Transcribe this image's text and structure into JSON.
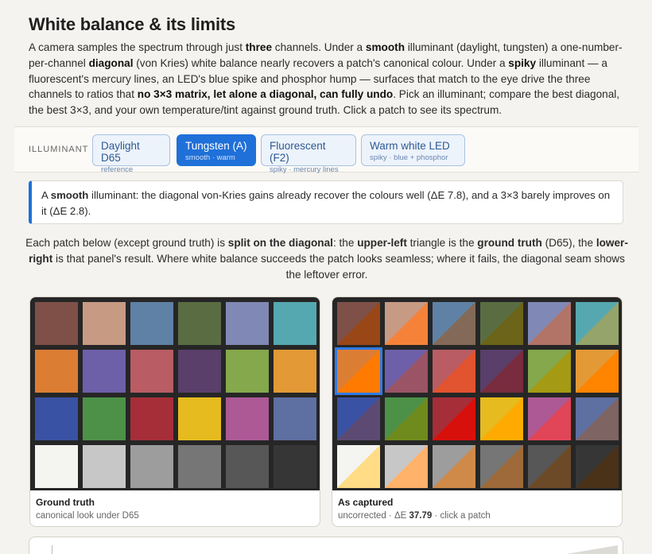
{
  "title": "White balance & its limits",
  "intro": {
    "p1": "A camera samples the spectrum through just ",
    "b1": "three",
    "p2": " channels. Under a ",
    "b2": "smooth",
    "p3": " illuminant (daylight, tungsten) a one-number-per-channel ",
    "b3": "diagonal",
    "p4": " (von Kries) white balance nearly recovers a patch's canonical colour. Under a ",
    "b4": "spiky",
    "p5": " illuminant — a fluorescent's mercury lines, an LED's blue spike and phosphor hump — surfaces that match to the eye drive the three channels to ratios that ",
    "b5": "no 3×3 matrix, let alone a diagonal, can fully undo",
    "p6": ". Pick an illuminant; compare the best diagonal, the best 3×3, and your own temperature/tint against ground truth. Click a patch to see its spectrum."
  },
  "toolbar": {
    "label": "ILLUMINANT",
    "options": [
      {
        "name": "Daylight D65",
        "sub": "reference"
      },
      {
        "name": "Tungsten (A)",
        "sub": "smooth · warm"
      },
      {
        "name": "Fluorescent (F2)",
        "sub": "spiky · mercury lines"
      },
      {
        "name": "Warm white LED",
        "sub": "spiky · blue + phosphor"
      }
    ],
    "active_index": 1
  },
  "note": {
    "p1": "A ",
    "b1": "smooth",
    "p2": " illuminant: the diagonal von-Kries gains already recover the colours well (ΔE 7.8), and a 3×3 barely improves on it (ΔE 2.8)."
  },
  "explain": {
    "p1": "Each patch below (except ground truth) is ",
    "b1": "split on the diagonal",
    "p2": ": the ",
    "b2": "upper-left",
    "p3": " triangle is the ",
    "b3": "ground truth",
    "p4": " (D65), the ",
    "b4": "lower-right",
    "p5": " is that panel's result. Where white balance succeeds the patch looks seamless; where it fails, the diagonal seam shows the leftover error."
  },
  "panels": {
    "ground_truth": {
      "title": "Ground truth",
      "sub": "canonical look under D65"
    },
    "captured": {
      "title": "As captured",
      "sub_pre": "uncorrected · ΔE ",
      "delta_e": "37.79",
      "sub_post": " · click a patch"
    }
  },
  "colors": {
    "accent": "#1f70d8",
    "ground_truth": [
      "#7e5048",
      "#c79a84",
      "#5f81a5",
      "#5a6d42",
      "#8089b5",
      "#56a8b0",
      "#dc7d34",
      "#6e5fa9",
      "#b95c63",
      "#593f6a",
      "#84a84b",
      "#e39935",
      "#3a52a3",
      "#4d9148",
      "#a52e38",
      "#e6bb1f",
      "#ac5996",
      "#5e6fa2",
      "#f4f4f1",
      "#c7c7c7",
      "#9d9d9d",
      "#767676",
      "#575757",
      "#363636"
    ],
    "captured": [
      "#9a4718",
      "#f6823a",
      "#836a58",
      "#6c6418",
      "#b27467",
      "#94a46a",
      "#ff7a00",
      "#9a5466",
      "#e2542f",
      "#782c3e",
      "#a49a13",
      "#ff8400",
      "#5c4a72",
      "#6f8b1e",
      "#d8100c",
      "#ffaa00",
      "#e04658",
      "#7e6462",
      "#ffdc85",
      "#ffb26a",
      "#cf8a4a",
      "#9e6a3a",
      "#6d4a27",
      "#4a3218"
    ]
  },
  "selected_patch": 6
}
